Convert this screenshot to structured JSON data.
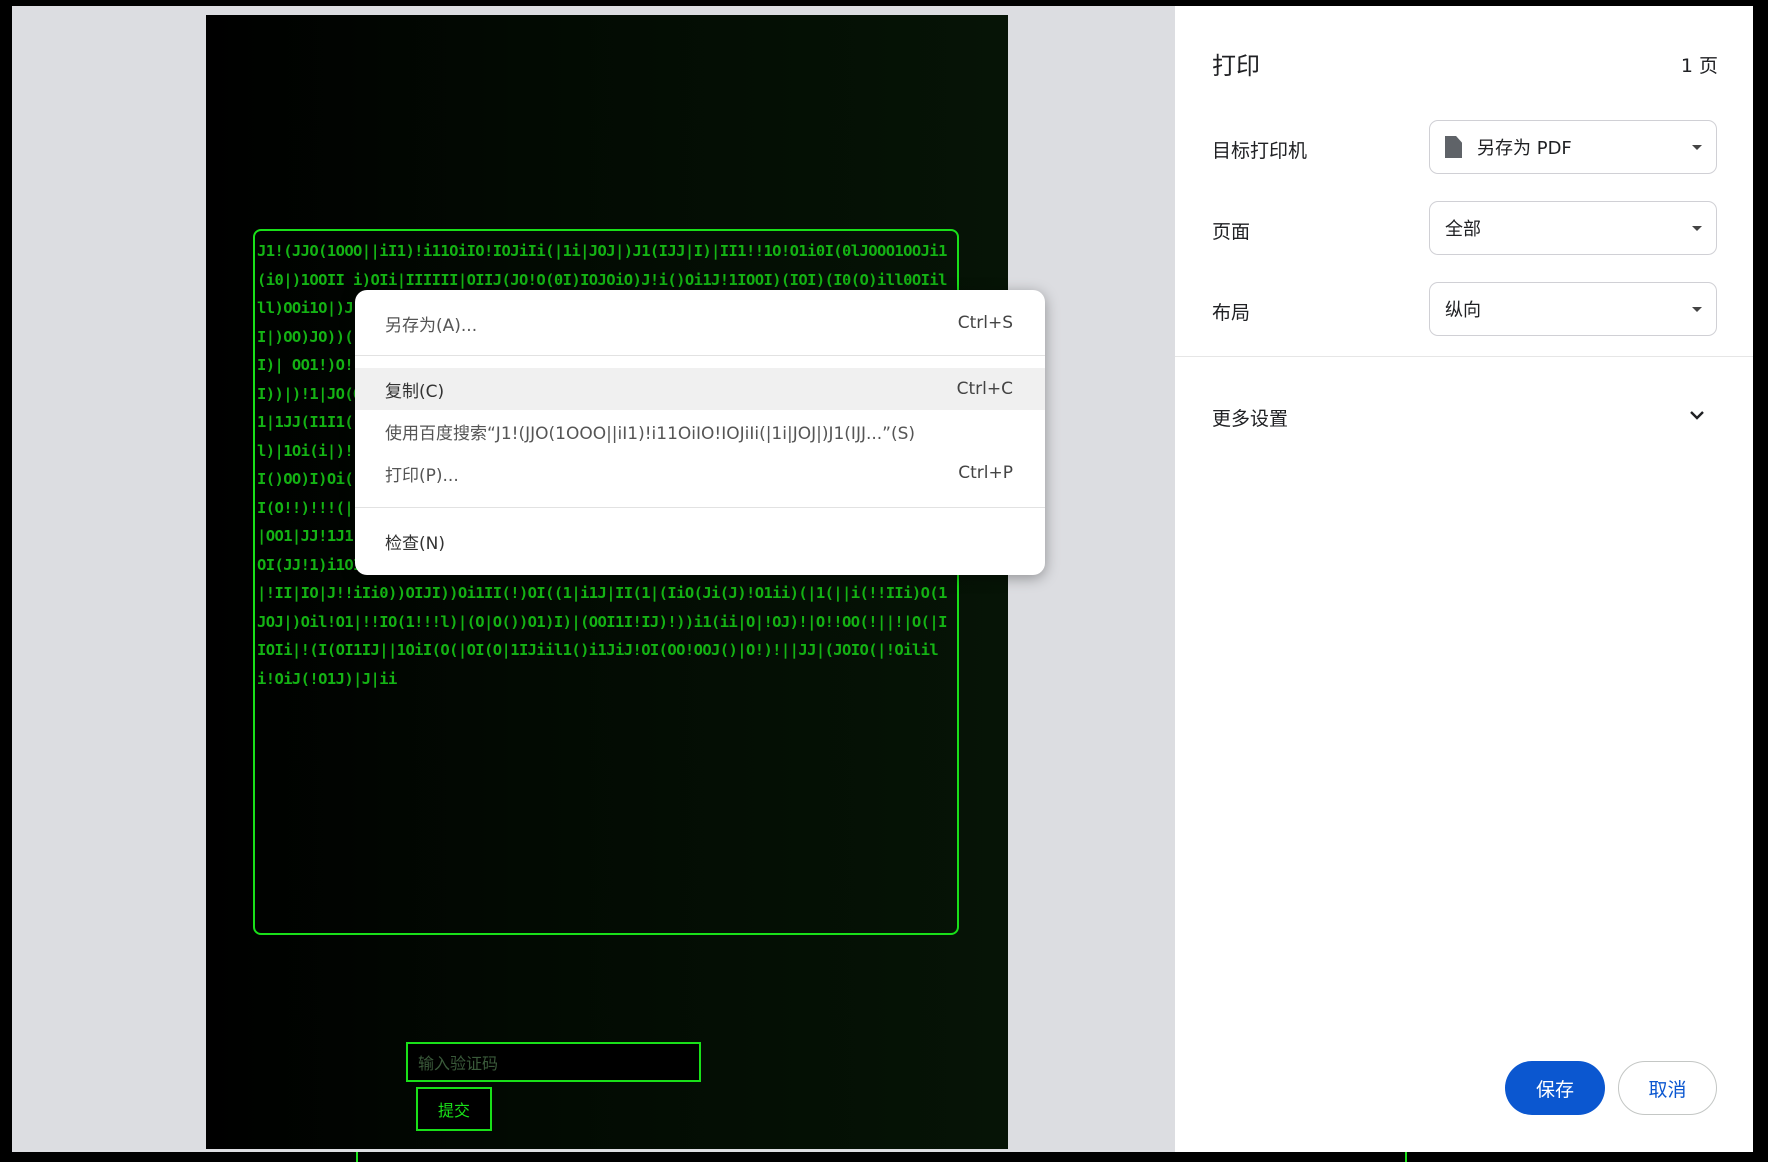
{
  "preview": {
    "code_text": "J1!(JJO(1OOO||iI1)!i11OiIO!IOJiIi(|1i|JOJ|)J1(IJJ|I)|II1!!1O!O1i0I(0lJOOO1OOJi1(i0|)1OOII i)OIi|IIIIII|OIIJ(JO!O(0I)IOJOiO)J!i()Oi1J!1IOOI)(IOI)(I0(O)ill0OIilll)OOi1O|)J!|iOIJ)|IO|)O)I!! 0!iI1(|))iOIJO ))(JIII(|)IIO! |JI)|0)|i)))1Oi OIIII|)OO)JO))( )1(i|II)1!|O!J IIl!1!1I1OO !|)O1|1I1|I|! 0i(|JJO1|J|O1 J!iI|)iII1III)| OO1!)O!)|J|)|i!!IO|OJOIIIJ|)|IIJ|OI(OOJ1(!!i)OII|IOl(|((IIii!)I|OIOOIIOOOI)I))|)!1|JO(OOlOI(1IOJ(|I!!iOiIO(OO!)O1!J)(||(((IJ!!i|!|O1JOiJ1i)I1)J|IJJI1iIJ!O1|1JJ(I1I1()!!||!|JJiJ!|III!I(IIiI!)((O!)(J)OOJ1)J)!||(i(1O|!iJ!1)|i1Oilll1O)Oll)|1Oi(i|)!!|Oll)|OJ1|1I(1OOJO)1IJ(!((!!I(1!))J!|IJO1)JOIIOO)!!1iOJ!OJi!OO|!OOOI()OO)I)Oi(|1IO1(O(i1!!i!1!)!i(1)!11iiJ)iO1!iJ)OI1i|OJOi!!1!1(|O!O(!|)iJ!()Ii!OI(O!!)!!!(|!|)iOI|)1IO(1IOII11iOJ!()!!(O1!|i))|!IOIOI1Ji(iOl1iOIOJ!i11JiJ)IiIJJ|OO1|JJ!1J1!)|Oi)|O!!OO|O|1l(J(||ii)iO|(O!!O|I(i1(!|1IOOO|O)I)J)O||IO(!!i!IO(JOOI(JJ!1)i1OII(1||IO|i!l))|!iJ!iOII1JOI)!i)111J!1(!)|!OJi(1!lJ!1|O1J|OO|!Oi|!||)|!II|IO|J!!iIi0))OIJI))Oi1II(!)OI((1|i1J|II(1|(IiO(Ji(J)!O1ii)(|1(||i(!!IIi)O(1JOJ|)Oil!O1|!!IO(1!!!l)|(O|O())O1)I)|(OOI1I!IJ)!))i1(ii|O|!OJ)!|O!!OO(!||!|O(|IIOIi|!(I(OI1IJ||1OiI(O(|OI(O|1IJiil1()i1JiJ!OI(OO!OOJ()|O!)!||JJ|(JOIO(|!Oilili!OiJ(!O1J)|J|ii",
    "captcha_placeholder": "输入验证码",
    "submit_label": "提交"
  },
  "context_menu": {
    "items": [
      {
        "label": "另存为(A)...",
        "shortcut": "Ctrl+S"
      },
      {
        "label": "复制(C)",
        "shortcut": "Ctrl+C"
      },
      {
        "label": "使用百度搜索“J1!(JJO(1OOO||iI1)!i11OiIO!IOJiIi(|1i|JOJ|)J1(IJJ...”(S)",
        "shortcut": ""
      },
      {
        "label": "打印(P)...",
        "shortcut": "Ctrl+P"
      },
      {
        "label": "检查(N)",
        "shortcut": ""
      }
    ]
  },
  "print_panel": {
    "title": "打印",
    "page_count": "1 页",
    "settings": [
      {
        "label": "目标打印机",
        "value": "另存为 PDF"
      },
      {
        "label": "页面",
        "value": "全部"
      },
      {
        "label": "布局",
        "value": "纵向"
      }
    ],
    "more_settings_label": "更多设置",
    "save_label": "保存",
    "cancel_label": "取消"
  },
  "colors": {
    "accent_blue": "#0b57d0",
    "matrix_green": "#19e019",
    "preview_gray": "#dcdde1"
  },
  "icons": {
    "printer_icon": "document-icon",
    "dropdown_icon": "caret-down-icon",
    "expand_icon": "chevron-down-icon"
  }
}
